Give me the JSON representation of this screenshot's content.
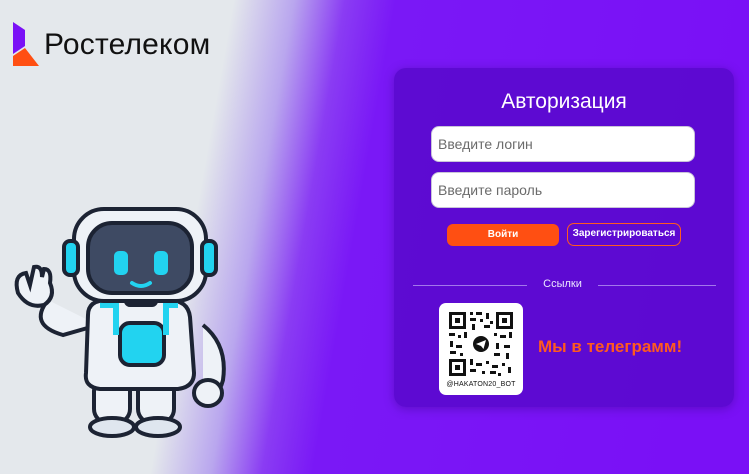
{
  "brand": {
    "name": "Ростелеком",
    "accent": "#ff4f12",
    "purple": "#7a10f6"
  },
  "auth": {
    "title": "Авторизация",
    "login_placeholder": "Введите логин",
    "password_placeholder": "Введите пароль",
    "login_button": "Войти",
    "register_button": "Зарегистрироваться"
  },
  "links": {
    "section_label": "Ссылки",
    "qr_caption": "@HAKATON20_BOT",
    "telegram_text": "Мы в телеграмм!"
  },
  "icons": [
    "rostelecom-logo-icon",
    "robot-mascot-icon",
    "qr-code-icon",
    "telegram-icon"
  ]
}
